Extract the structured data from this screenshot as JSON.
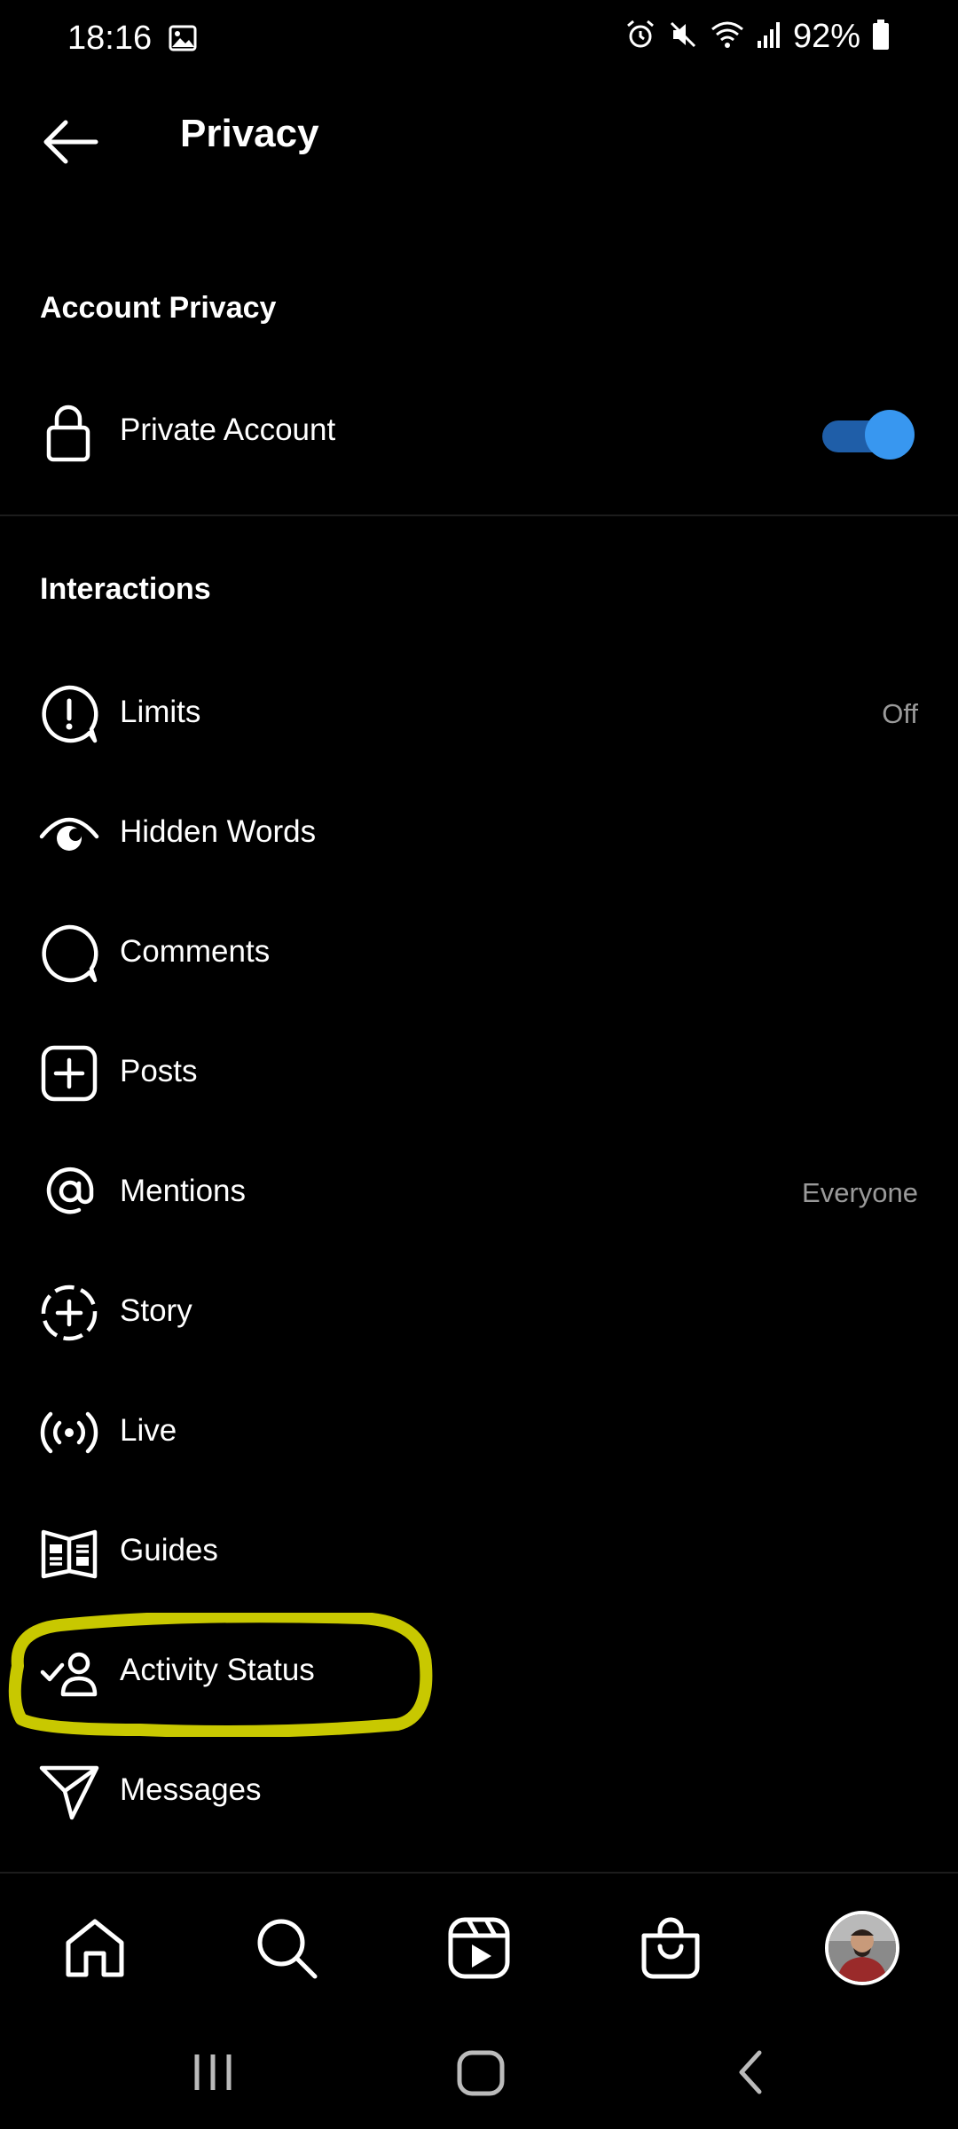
{
  "status_bar": {
    "time": "18:16",
    "battery": "92%"
  },
  "header": {
    "title": "Privacy"
  },
  "account_privacy": {
    "section_title": "Account Privacy",
    "private_account": {
      "label": "Private Account",
      "enabled": true,
      "icon": "lock-icon"
    }
  },
  "interactions": {
    "section_title": "Interactions",
    "items": [
      {
        "label": "Limits",
        "value": "Off",
        "icon": "limits-icon"
      },
      {
        "label": "Hidden Words",
        "value": "",
        "icon": "hidden-words-icon"
      },
      {
        "label": "Comments",
        "value": "",
        "icon": "comment-icon"
      },
      {
        "label": "Posts",
        "value": "",
        "icon": "plus-square-icon"
      },
      {
        "label": "Mentions",
        "value": "Everyone",
        "icon": "at-sign-icon"
      },
      {
        "label": "Story",
        "value": "",
        "icon": "story-add-icon"
      },
      {
        "label": "Live",
        "value": "",
        "icon": "live-icon"
      },
      {
        "label": "Guides",
        "value": "",
        "icon": "guides-icon"
      },
      {
        "label": "Activity Status",
        "value": "",
        "icon": "activity-status-icon"
      },
      {
        "label": "Messages",
        "value": "",
        "icon": "send-icon"
      }
    ]
  },
  "highlight": {
    "color": "#c8c800",
    "target": "Activity Status"
  },
  "bottom_nav": {
    "items": [
      "home-icon",
      "search-icon",
      "reels-icon",
      "shop-icon",
      "profile-avatar"
    ]
  },
  "colors": {
    "background": "#000000",
    "toggle_track": "#1f5ea8",
    "toggle_knob": "#3897f0",
    "secondary_text": "#9a9a9a"
  }
}
